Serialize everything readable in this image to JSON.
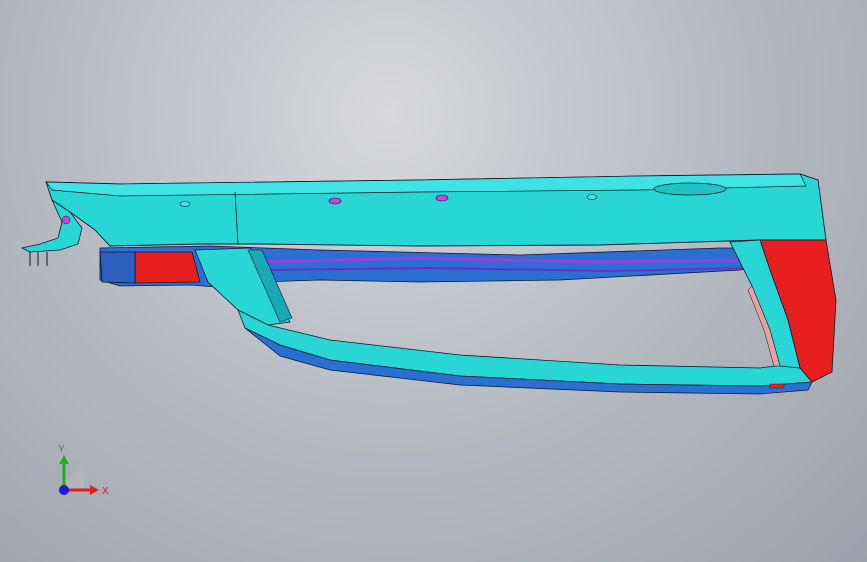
{
  "viewport": {
    "background_top": "#d6d8dc",
    "background_bottom": "#9da3ac"
  },
  "model": {
    "name_icon": "bumper-assembly-3d-model",
    "colors": {
      "main_surface": "#29d6d6",
      "main_surface_dark": "#1aa9b4",
      "inner_blue": "#2a6fd1",
      "red_part": "#e61e1e",
      "purple_holes": "#d040e0",
      "edge_lines": "#0b1a2a"
    }
  },
  "triad": {
    "x_label": "X",
    "y_label": "Y",
    "x_color": "#e02020",
    "y_color": "#20b020",
    "z_color": "#1a1ad8"
  }
}
